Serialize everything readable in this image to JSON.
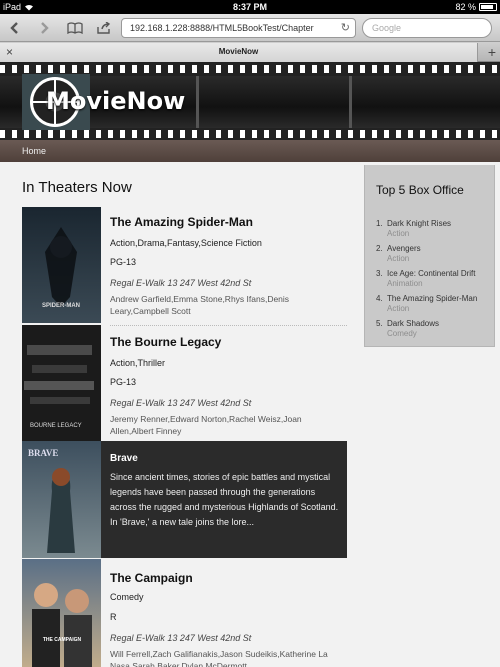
{
  "status_bar": {
    "carrier": "iPad",
    "time": "8:37 PM",
    "battery": "82 %"
  },
  "browser": {
    "url": "192.168.1.228:8888/HTML5BookTest/Chapter",
    "search_placeholder": "Google",
    "tab_title": "MovieNow"
  },
  "site": {
    "logo_text": "MovieNow",
    "nav": {
      "home": "Home"
    }
  },
  "main": {
    "section_title": "In Theaters Now",
    "movies": [
      {
        "title": "The Amazing Spider-Man",
        "genres": "Action,Drama,Fantasy,Science Fiction",
        "rating": "PG-13",
        "theater": "Regal E-Walk 13 247 West 42nd St",
        "cast": "Andrew Garfield,Emma Stone,Rhys Ifans,Denis Leary,Campbell Scott",
        "poster_caption": "SPIDER-MAN",
        "poster_colors": [
          "#1a2630",
          "#3b4a55"
        ]
      },
      {
        "title": "The Bourne Legacy",
        "genres": "Action,Thriller",
        "rating": "PG-13",
        "theater": "Regal E-Walk 13 247 West 42nd St",
        "cast": "Jeremy Renner,Edward Norton,Rachel Weisz,Joan Allen,Albert Finney",
        "poster_caption": "BOURNE LEGACY",
        "poster_colors": [
          "#1b1b1b",
          "#4a4a4a"
        ]
      },
      {
        "title": "Brave",
        "description": "Since ancient times, stories of epic battles and mystical legends have been passed through the generations across the rugged and mysterious Highlands of Scotland. In 'Brave,' a new tale joins the lore...",
        "poster_caption": "BRAVE",
        "poster_colors": [
          "#3d4f5e",
          "#7b8a90"
        ]
      },
      {
        "title": "The Campaign",
        "genres": "Comedy",
        "rating": "R",
        "theater": "Regal E-Walk 13 247 West 42nd St",
        "cast": "Will Ferrell,Zach Galifianakis,Jason Sudeikis,Katherine La Nasa,Sarah Baker,Dylan McDermott",
        "poster_caption": "THE CAMPAIGN",
        "poster_colors": [
          "#5a6f86",
          "#c9b18c"
        ]
      }
    ]
  },
  "sidebar": {
    "title": "Top 5 Box Office",
    "items": [
      {
        "rank": "1.",
        "name": "Dark Knight Rises",
        "genre": "Action"
      },
      {
        "rank": "2.",
        "name": "Avengers",
        "genre": "Action"
      },
      {
        "rank": "3.",
        "name": "Ice Age: Continental Drift",
        "genre": "Animation"
      },
      {
        "rank": "4.",
        "name": "The Amazing Spider-Man",
        "genre": "Action"
      },
      {
        "rank": "5.",
        "name": "Dark Shadows",
        "genre": "Comedy"
      }
    ]
  }
}
